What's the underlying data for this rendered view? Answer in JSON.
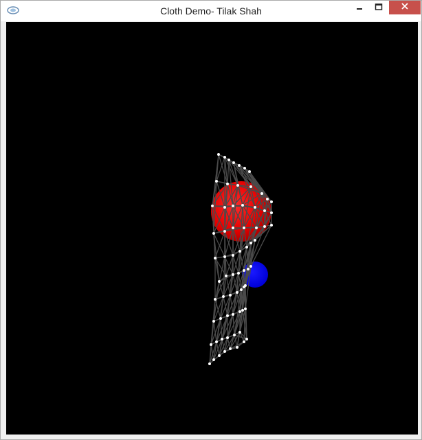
{
  "window": {
    "title": "Cloth Demo- Tilak Shah",
    "icon": "opengl-app-icon",
    "controls": [
      "minimize-icon",
      "maximize-icon",
      "close-icon"
    ]
  },
  "colors": {
    "viewport_background": "#000000",
    "cloth_mesh": "#4a4a4a",
    "cloth_nodes": "#ffffff",
    "red_sphere": "#ff0000",
    "blue_sphere": "#0000ff",
    "close_button": "#c7504b"
  }
}
